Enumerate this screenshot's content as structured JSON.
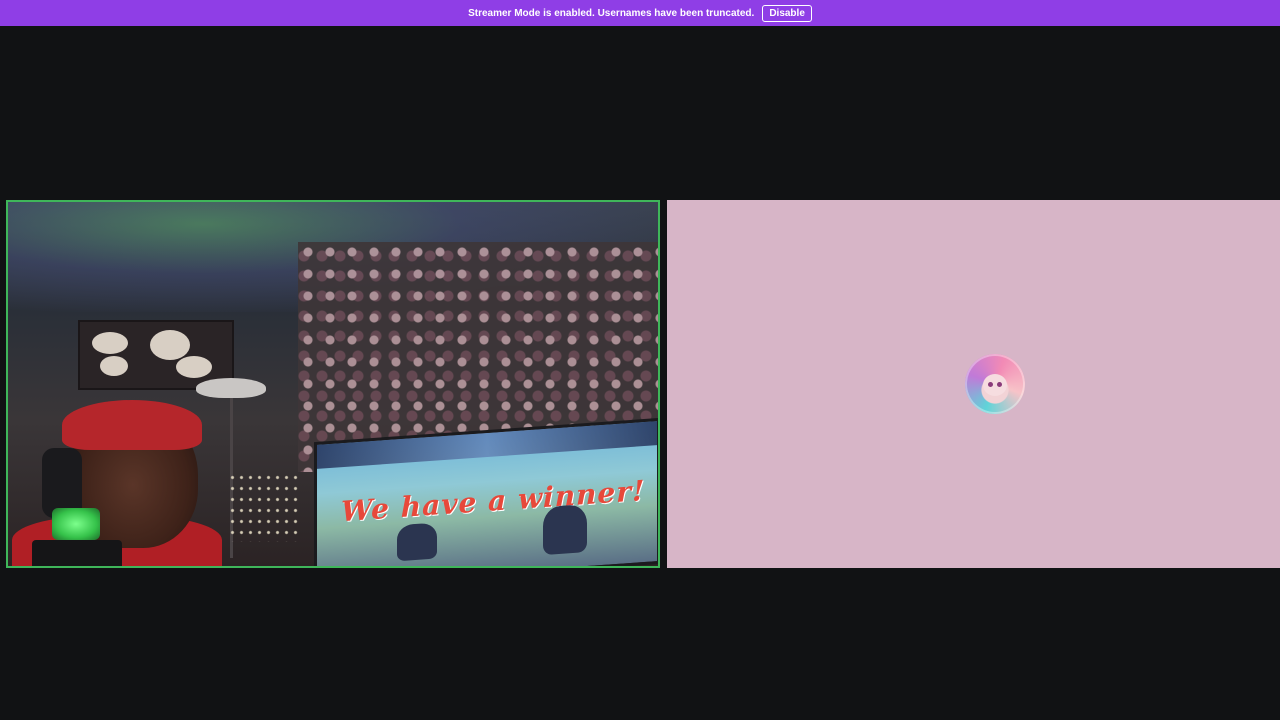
{
  "banner": {
    "message": "Streamer Mode is enabled. Usernames have been truncated.",
    "disable_label": "Disable",
    "background": "#8f3ee6"
  },
  "stage": {
    "background": "#111214"
  },
  "tiles": {
    "video": {
      "speaking_border": "#3fb65a",
      "screen_text": "We have a winner!"
    },
    "avatar": {
      "background": "#d7b5c7",
      "icon": "user-avatar-icon"
    }
  }
}
